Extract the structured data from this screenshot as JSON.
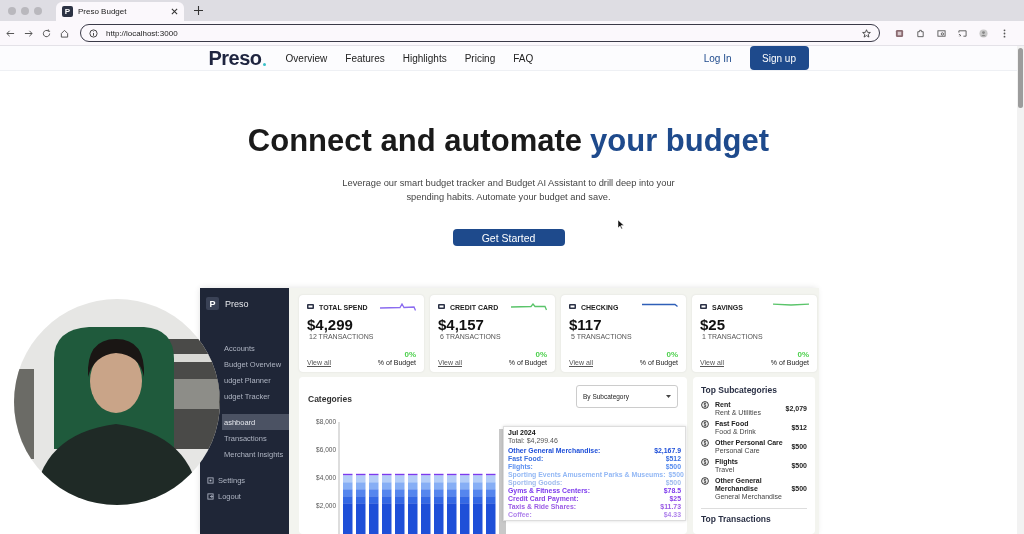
{
  "browser": {
    "tabs": [
      {
        "title": "Preso Budget",
        "favicon": "P",
        "selected": true
      }
    ],
    "url": "http://localhost:3000"
  },
  "nav": {
    "logo": "Preso",
    "links": [
      "Overview",
      "Features",
      "Highlights",
      "Pricing",
      "FAQ"
    ],
    "login": "Log In",
    "signup": "Sign up"
  },
  "hero": {
    "title": "Connect and automate",
    "title_highlight": "your budget",
    "subtitle": "Leverage our smart budget tracker and Budget AI Assistant to drill deep into your spending habits. Automate your budget and save.",
    "cta": "Get Started"
  },
  "dashboard": {
    "sidebar": {
      "logo_mark": "P",
      "logo": "Preso",
      "groups": [
        [
          {
            "label": "Accounts",
            "selected": false,
            "icon": false
          },
          {
            "label": "Budget Overview",
            "selected": false,
            "icon": false
          },
          {
            "label": "udget Planner",
            "selected": false,
            "icon": false
          },
          {
            "label": "udget Tracker",
            "selected": false,
            "icon": false
          }
        ],
        [
          {
            "label": "ashboard",
            "selected": true,
            "icon": false
          },
          {
            "label": "Transactions",
            "selected": false,
            "icon": false
          },
          {
            "label": "Merchant Insights",
            "selected": false,
            "icon": false
          }
        ],
        [
          {
            "label": "Settings",
            "selected": false,
            "icon": true
          },
          {
            "label": "Logout",
            "selected": false,
            "icon": true
          }
        ]
      ]
    },
    "cards": [
      {
        "title": "TOTAL SPEND",
        "value": "$4,299",
        "transactions": "12 TRANSACTIONS",
        "percent": "0%",
        "percent_label": "% of Budget",
        "link": "View all",
        "color": "#8b6cf0"
      },
      {
        "title": "CREDIT CARD",
        "value": "$4,157",
        "transactions": "6 TRANSACTIONS",
        "percent": "0%",
        "percent_label": "% of Budget",
        "link": "View all",
        "color": "#5ac46a"
      },
      {
        "title": "CHECKING",
        "value": "$117",
        "transactions": "5 TRANSACTIONS",
        "percent": "0%",
        "percent_label": "% of Budget",
        "link": "View all",
        "color": "#2f5fb8"
      },
      {
        "title": "SAVINGS",
        "value": "$25",
        "transactions": "1 TRANSACTIONS",
        "percent": "0%",
        "percent_label": "% of Budget",
        "link": "View all",
        "color": "#5ac46a"
      }
    ],
    "categories": {
      "title": "Categories",
      "select": "By Subcategory",
      "chart_data": {
        "type": "bar",
        "stacked": true,
        "categories": [
          null,
          null,
          null,
          null,
          null,
          null,
          null,
          null,
          null,
          null,
          null,
          null
        ],
        "ylim": [
          0,
          8000
        ],
        "yticks": [
          {
            "value": 2000,
            "label": "$2,000"
          },
          {
            "value": 4000,
            "label": "$4,000"
          },
          {
            "value": 6000,
            "label": "$6,000"
          },
          {
            "value": 8000,
            "label": "$8,000"
          }
        ],
        "series": [
          {
            "color": "#1e4fd8",
            "values": [
              2200,
              2200,
              2200,
              2200,
              2200,
              2200,
              2200,
              2200,
              2200,
              2200,
              2200,
              2200
            ]
          },
          {
            "color": "#3468e4",
            "values": [
              500,
              500,
              500,
              500,
              500,
              500,
              500,
              500,
              500,
              500,
              500,
              500
            ]
          },
          {
            "color": "#5586ee",
            "values": [
              500,
              500,
              500,
              500,
              500,
              500,
              500,
              500,
              500,
              500,
              500,
              500
            ]
          },
          {
            "color": "#86aef5",
            "values": [
              500,
              500,
              500,
              500,
              500,
              500,
              500,
              500,
              500,
              500,
              500,
              500
            ]
          },
          {
            "color": "#b3cdf8",
            "values": [
              500,
              500,
              500,
              500,
              500,
              500,
              500,
              500,
              500,
              500,
              500,
              500
            ]
          },
          {
            "color": "#7c3aed",
            "values": [
              100,
              100,
              100,
              100,
              100,
              100,
              100,
              100,
              100,
              100,
              100,
              100
            ]
          }
        ]
      },
      "tooltip": {
        "title": "Jul 2024",
        "total": "Total: $4,299.46",
        "items": [
          {
            "label": "Other General Merchandise:",
            "amount": "$2,167.9",
            "color": "#1d4ed8"
          },
          {
            "label": "Fast Food:",
            "amount": "$512",
            "color": "#3b6fe0"
          },
          {
            "label": "Flights:",
            "amount": "$500",
            "color": "#5b8ff0"
          },
          {
            "label": "Sporting Events Amusement Parks & Museums:",
            "amount": "$500",
            "color": "#93b8f5"
          },
          {
            "label": "Sporting Goods:",
            "amount": "$500",
            "color": "#9fbcee"
          },
          {
            "label": "Gyms & Fitness Centers:",
            "amount": "$78.5",
            "color": "#7c3aed"
          },
          {
            "label": "Credit Card Payment:",
            "amount": "$25",
            "color": "#8b45e8"
          },
          {
            "label": "Taxis & Ride Shares:",
            "amount": "$11.73",
            "color": "#9b5de5"
          },
          {
            "label": "Coffee:",
            "amount": "$4.33",
            "color": "#b084ec"
          }
        ]
      }
    },
    "top_subcategories": {
      "title": "Top Subcategories",
      "items": [
        {
          "name": "Rent",
          "category": "Rent & Utilities",
          "amount": "$2,079"
        },
        {
          "name": "Fast Food",
          "category": "Food & Drink",
          "amount": "$512"
        },
        {
          "name": "Other Personal Care",
          "category": "Personal Care",
          "amount": "$500"
        },
        {
          "name": "Flights",
          "category": "Travel",
          "amount": "$500"
        },
        {
          "name": "Other General Merchandise",
          "category": "General Merchandise",
          "amount": "$500"
        }
      ],
      "next_title": "Top Transactions"
    }
  }
}
